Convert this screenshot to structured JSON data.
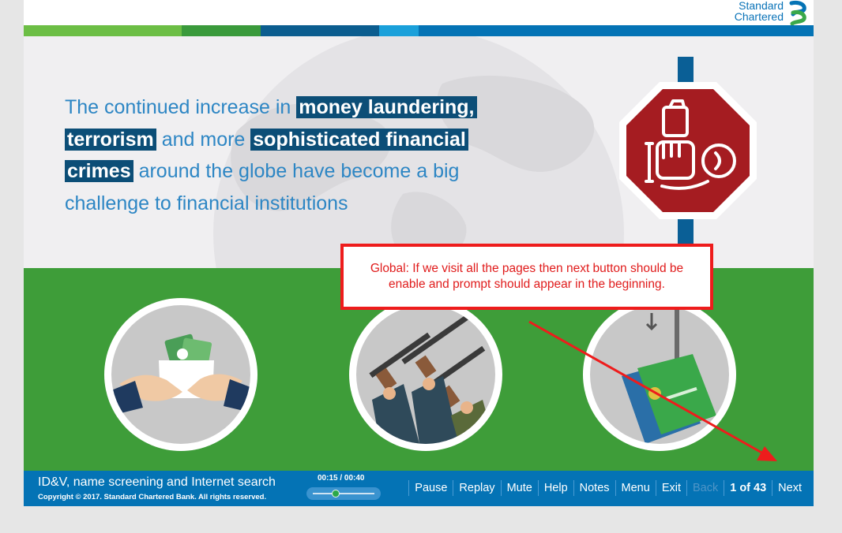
{
  "brand": {
    "line1": "Standard",
    "line2": "Chartered",
    "colors": [
      "#6cbe45",
      "#3a9a3b",
      "#0b5d8f",
      "#1aa0da",
      "#0473b5"
    ]
  },
  "headline": {
    "t1": "The continued increase in ",
    "h1": "money laundering,",
    "h2": "terrorism",
    "t2": " and more ",
    "h3": "sophisticated financial",
    "h4": "crimes",
    "t3": " around the globe have become a big challenge to financial institutions"
  },
  "illustrations": {
    "stop_sign": "money-and-handcuffs-stop-sign-icon",
    "circles": [
      "hands-passing-money-envelope-icon",
      "armed-men-rifles-icon",
      "card-on-fishing-hook-icon"
    ]
  },
  "annotation": {
    "text": "Global: If we visit all the pages then next button should be enable and prompt should appear in the beginning."
  },
  "footer": {
    "course_title": "ID&V, name screening and Internet search",
    "copyright": "Copyright © 2017. Standard Chartered Bank. All rights reserved.",
    "timer": "00:15 / 00:40",
    "progress": 0.375,
    "nav": {
      "pause": "Pause",
      "replay": "Replay",
      "mute": "Mute",
      "help": "Help",
      "notes": "Notes",
      "menu": "Menu",
      "exit": "Exit",
      "back": "Back",
      "page_count": "1 of 43",
      "next": "Next"
    }
  },
  "colors": {
    "accent_blue": "#0473b5",
    "green": "#3e9d39",
    "stop_red": "#a51c21",
    "annotation_red": "#ee1c1c",
    "highlight": "#0c4e77"
  }
}
